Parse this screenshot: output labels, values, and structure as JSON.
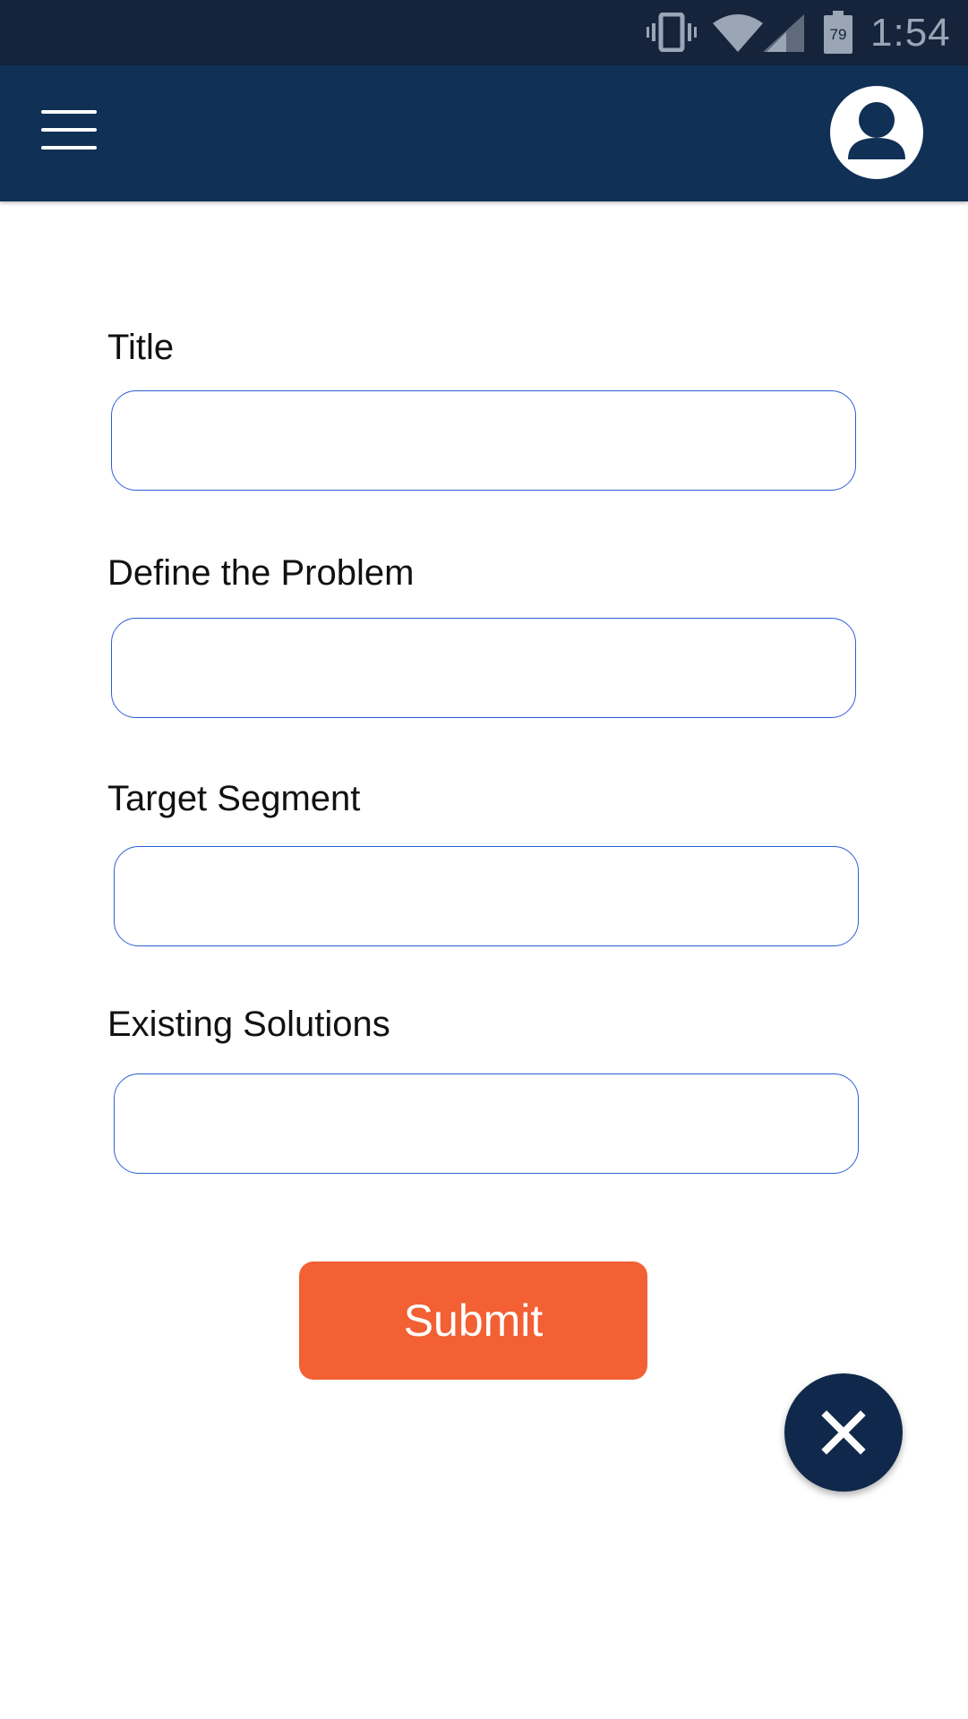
{
  "status_bar": {
    "time": "1:54",
    "battery_level": "79",
    "icons": [
      "vibrate-icon",
      "wifi-icon",
      "cell-signal-icon",
      "battery-icon"
    ]
  },
  "app_bar": {
    "menu_icon": "hamburger-menu-icon",
    "profile_icon": "user-avatar-icon"
  },
  "form": {
    "fields": [
      {
        "label": "Title",
        "value": "",
        "placeholder": ""
      },
      {
        "label": "Define the Problem",
        "value": "",
        "placeholder": ""
      },
      {
        "label": "Target Segment",
        "value": "",
        "placeholder": ""
      },
      {
        "label": "Existing Solutions",
        "value": "",
        "placeholder": ""
      }
    ],
    "submit_label": "Submit"
  },
  "fab": {
    "icon": "close-icon"
  },
  "colors": {
    "status_bar_bg": "#16243b",
    "app_bar_bg": "#113056",
    "input_border": "#2c5fd6",
    "submit_bg": "#f26033",
    "fab_bg": "#10284c"
  }
}
